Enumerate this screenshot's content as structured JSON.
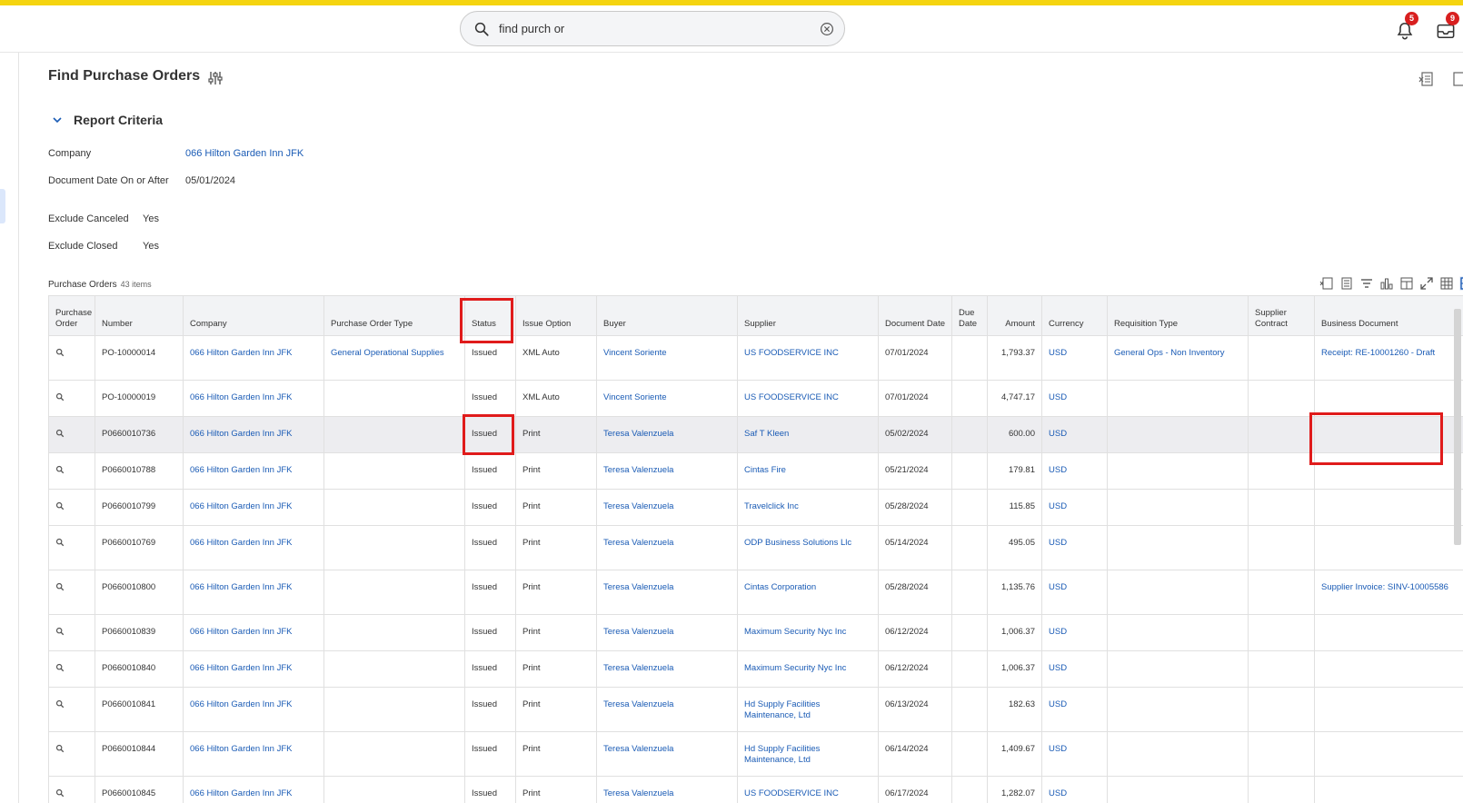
{
  "search": {
    "query": "find purch or"
  },
  "notifications": {
    "bell_count": "5",
    "inbox_count": "9"
  },
  "page": {
    "title": "Find Purchase Orders"
  },
  "criteria": {
    "title": "Report Criteria",
    "company_label": "Company",
    "company_value": "066 Hilton Garden Inn JFK",
    "doc_date_label": "Document Date On or After",
    "doc_date_value": "05/01/2024",
    "exclude_canceled_label": "Exclude Canceled",
    "exclude_canceled_value": "Yes",
    "exclude_closed_label": "Exclude Closed",
    "exclude_closed_value": "Yes"
  },
  "grid": {
    "label": "Purchase Orders",
    "count": "43 items",
    "columns": [
      "Purchase Order",
      "Number",
      "Company",
      "Purchase Order Type",
      "Status",
      "Issue Option",
      "Buyer",
      "Supplier",
      "Document Date",
      "Due Date",
      "Amount",
      "Currency",
      "Requisition Type",
      "Supplier Contract",
      "Business Document"
    ],
    "rows": [
      {
        "number": "PO-10000014",
        "company": "066 Hilton Garden Inn JFK",
        "po_type": "General Operational Supplies",
        "status": "Issued",
        "issue_option": "XML Auto",
        "buyer": "Vincent Soriente",
        "supplier": "US FOODSERVICE INC",
        "doc_date": "07/01/2024",
        "due_date": "",
        "amount": "1,793.37",
        "currency": "USD",
        "req_type": "General Ops - Non Inventory",
        "contract": "",
        "business_doc": "Receipt: RE-10001260 - Draft"
      },
      {
        "number": "PO-10000019",
        "company": "066 Hilton Garden Inn JFK",
        "po_type": "",
        "status": "Issued",
        "issue_option": "XML Auto",
        "buyer": "Vincent Soriente",
        "supplier": "US FOODSERVICE INC",
        "doc_date": "07/01/2024",
        "due_date": "",
        "amount": "4,747.17",
        "currency": "USD",
        "req_type": "",
        "contract": "",
        "business_doc": ""
      },
      {
        "number": "P0660010736",
        "company": "066 Hilton Garden Inn JFK",
        "po_type": "",
        "status": "Issued",
        "issue_option": "Print",
        "buyer": "Teresa Valenzuela",
        "supplier": "Saf T Kleen",
        "doc_date": "05/02/2024",
        "due_date": "",
        "amount": "600.00",
        "currency": "USD",
        "req_type": "",
        "contract": "",
        "business_doc": ""
      },
      {
        "number": "P0660010788",
        "company": "066 Hilton Garden Inn JFK",
        "po_type": "",
        "status": "Issued",
        "issue_option": "Print",
        "buyer": "Teresa Valenzuela",
        "supplier": "Cintas Fire",
        "doc_date": "05/21/2024",
        "due_date": "",
        "amount": "179.81",
        "currency": "USD",
        "req_type": "",
        "contract": "",
        "business_doc": ""
      },
      {
        "number": "P0660010799",
        "company": "066 Hilton Garden Inn JFK",
        "po_type": "",
        "status": "Issued",
        "issue_option": "Print",
        "buyer": "Teresa Valenzuela",
        "supplier": "Travelclick Inc",
        "doc_date": "05/28/2024",
        "due_date": "",
        "amount": "115.85",
        "currency": "USD",
        "req_type": "",
        "contract": "",
        "business_doc": ""
      },
      {
        "number": "P0660010769",
        "company": "066 Hilton Garden Inn JFK",
        "po_type": "",
        "status": "Issued",
        "issue_option": "Print",
        "buyer": "Teresa Valenzuela",
        "supplier": "ODP Business Solutions Llc",
        "doc_date": "05/14/2024",
        "due_date": "",
        "amount": "495.05",
        "currency": "USD",
        "req_type": "",
        "contract": "",
        "business_doc": ""
      },
      {
        "number": "P0660010800",
        "company": "066 Hilton Garden Inn JFK",
        "po_type": "",
        "status": "Issued",
        "issue_option": "Print",
        "buyer": "Teresa Valenzuela",
        "supplier": "Cintas Corporation",
        "doc_date": "05/28/2024",
        "due_date": "",
        "amount": "1,135.76",
        "currency": "USD",
        "req_type": "",
        "contract": "",
        "business_doc": "Supplier Invoice: SINV-10005586"
      },
      {
        "number": "P0660010839",
        "company": "066 Hilton Garden Inn JFK",
        "po_type": "",
        "status": "Issued",
        "issue_option": "Print",
        "buyer": "Teresa Valenzuela",
        "supplier": "Maximum Security Nyc Inc",
        "doc_date": "06/12/2024",
        "due_date": "",
        "amount": "1,006.37",
        "currency": "USD",
        "req_type": "",
        "contract": "",
        "business_doc": ""
      },
      {
        "number": "P0660010840",
        "company": "066 Hilton Garden Inn JFK",
        "po_type": "",
        "status": "Issued",
        "issue_option": "Print",
        "buyer": "Teresa Valenzuela",
        "supplier": "Maximum Security Nyc Inc",
        "doc_date": "06/12/2024",
        "due_date": "",
        "amount": "1,006.37",
        "currency": "USD",
        "req_type": "",
        "contract": "",
        "business_doc": ""
      },
      {
        "number": "P0660010841",
        "company": "066 Hilton Garden Inn JFK",
        "po_type": "",
        "status": "Issued",
        "issue_option": "Print",
        "buyer": "Teresa Valenzuela",
        "supplier": "Hd Supply Facilities Maintenance, Ltd",
        "doc_date": "06/13/2024",
        "due_date": "",
        "amount": "182.63",
        "currency": "USD",
        "req_type": "",
        "contract": "",
        "business_doc": ""
      },
      {
        "number": "P0660010844",
        "company": "066 Hilton Garden Inn JFK",
        "po_type": "",
        "status": "Issued",
        "issue_option": "Print",
        "buyer": "Teresa Valenzuela",
        "supplier": "Hd Supply Facilities Maintenance, Ltd",
        "doc_date": "06/14/2024",
        "due_date": "",
        "amount": "1,409.67",
        "currency": "USD",
        "req_type": "",
        "contract": "",
        "business_doc": ""
      },
      {
        "number": "P0660010845",
        "company": "066 Hilton Garden Inn JFK",
        "po_type": "",
        "status": "Issued",
        "issue_option": "Print",
        "buyer": "Teresa Valenzuela",
        "supplier": "US FOODSERVICE INC",
        "doc_date": "06/17/2024",
        "due_date": "",
        "amount": "1,282.07",
        "currency": "USD",
        "req_type": "",
        "contract": "",
        "business_doc": ""
      }
    ]
  },
  "colors": {
    "accent_link": "#1a5bb5",
    "brand_stripe": "#f5d40f",
    "highlight_box": "#e01b1b",
    "badge": "#d81f1f"
  }
}
